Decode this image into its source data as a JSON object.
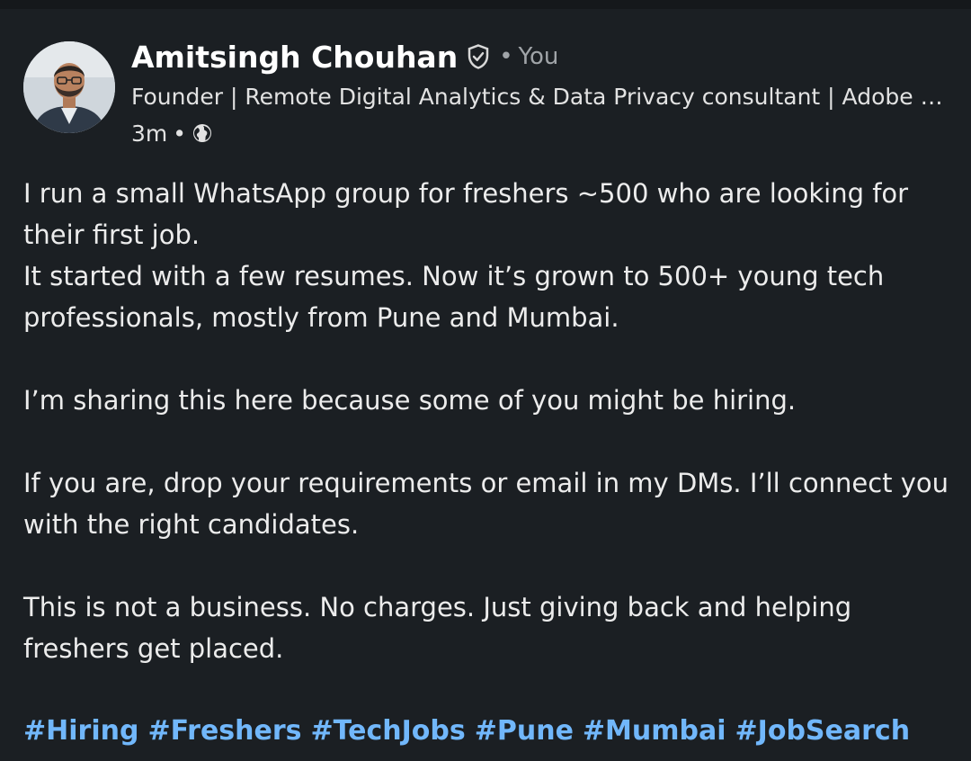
{
  "author": {
    "name": "Amitsingh Chouhan",
    "you_label": "You",
    "separator": "•",
    "headline": "Founder | Remote Digital Analytics & Data Privacy consultant | Adobe Analytics",
    "time": "3m",
    "time_separator": "•",
    "verified_icon": "shield-check-icon",
    "visibility_icon": "globe-icon"
  },
  "post": {
    "paragraph1_line1": "I run a small WhatsApp group for freshers ~500  who are looking for their first job.",
    "paragraph1_line2": "It started with a few resumes. Now it’s grown to 500+ young tech professionals, mostly from Pune and Mumbai.",
    "paragraph2": "I’m sharing this here because some of you might be hiring.",
    "paragraph3": "If you are, drop your requirements or email in my DMs. I’ll connect you with the right candidates.",
    "paragraph4": "This is not a business. No charges. Just giving back and helping freshers get placed.",
    "hashtags": [
      "#Hiring",
      "#Freshers",
      "#TechJobs",
      "#Pune",
      "#Mumbai",
      "#JobSearch"
    ]
  },
  "colors": {
    "background": "#1b1f23",
    "hashtag": "#71b7fb",
    "muted": "#a0a4a8"
  }
}
